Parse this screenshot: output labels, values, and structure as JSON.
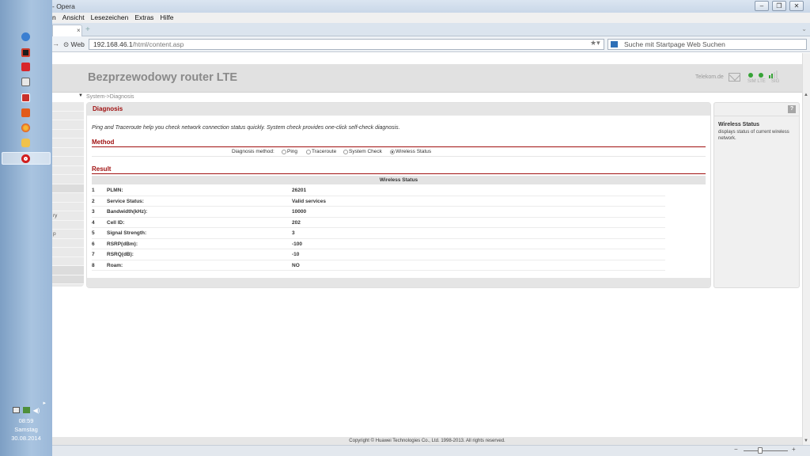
{
  "window": {
    "title": "- Opera",
    "controls": [
      "minimize-icon",
      "restore-icon",
      "close-icon"
    ]
  },
  "menu": {
    "items": [
      "n",
      "Ansicht",
      "Lesezeichen",
      "Extras",
      "Hilfe"
    ]
  },
  "tab": {
    "close": "×",
    "new_tab": "+"
  },
  "address_bar": {
    "badge": "Web",
    "url_host": "192.168.46.1",
    "url_path": "/html/content.asp",
    "search_placeholder": "Suche mit Startpage Web Suchen"
  },
  "taskbar": {
    "apps": [
      "ie-icon",
      "tweetdeck-icon",
      "flash-icon",
      "app-icon",
      "app-red-icon",
      "pdf-icon",
      "firefox-icon",
      "app-hand-icon",
      "opera-icon"
    ],
    "clock": {
      "time": "08:59",
      "day": "Samstag",
      "date": "30.08.2014"
    }
  },
  "router": {
    "title": "Bezprzewodowy router LTE",
    "provider": "Telekom.de",
    "indicators": {
      "sim_lte": "SIM LTE",
      "sig": "SIG"
    },
    "breadcrumb": "System->Diagnosis",
    "left_nav_fragments": [
      "",
      "",
      "",
      "",
      "",
      "",
      "",
      "",
      "",
      "",
      "",
      "",
      "ry",
      "",
      "p",
      "",
      "",
      "",
      "",
      ""
    ]
  },
  "diagnosis": {
    "heading": "Diagnosis",
    "intro": "Ping and Traceroute help you check network connection status quickly. System check provides one-click self-check diagnosis.",
    "method_section": "Method",
    "method_label": "Diagnosis method:",
    "methods": [
      {
        "label": "Ping",
        "selected": false
      },
      {
        "label": "Traceroute",
        "selected": false
      },
      {
        "label": "System Check",
        "selected": false
      },
      {
        "label": "Wireless Status",
        "selected": true
      }
    ],
    "result_section": "Result",
    "table_caption": "Wireless Status",
    "rows": [
      {
        "idx": "1",
        "name": "PLMN:",
        "value": "26201"
      },
      {
        "idx": "2",
        "name": "Service Status:",
        "value": "Valid services"
      },
      {
        "idx": "3",
        "name": "Bandwidth(kHz):",
        "value": "10000"
      },
      {
        "idx": "4",
        "name": "Cell ID:",
        "value": "202"
      },
      {
        "idx": "5",
        "name": "Signal Strength:",
        "value": "3"
      },
      {
        "idx": "6",
        "name": "RSRP(dBm):",
        "value": "-100"
      },
      {
        "idx": "7",
        "name": "RSRQ(dB):",
        "value": "-10"
      },
      {
        "idx": "8",
        "name": "Roam:",
        "value": "NO"
      }
    ]
  },
  "help": {
    "button": "?",
    "title": "Wireless Status",
    "text": "displays status of current wireless network."
  },
  "footer": "Copyright © Huawei Technologies Co., Ltd. 1998-2013. All rights reserved.",
  "colors": {
    "accent": "#a01010",
    "led": "#37a337",
    "taskbar": "#9bb8d8"
  }
}
